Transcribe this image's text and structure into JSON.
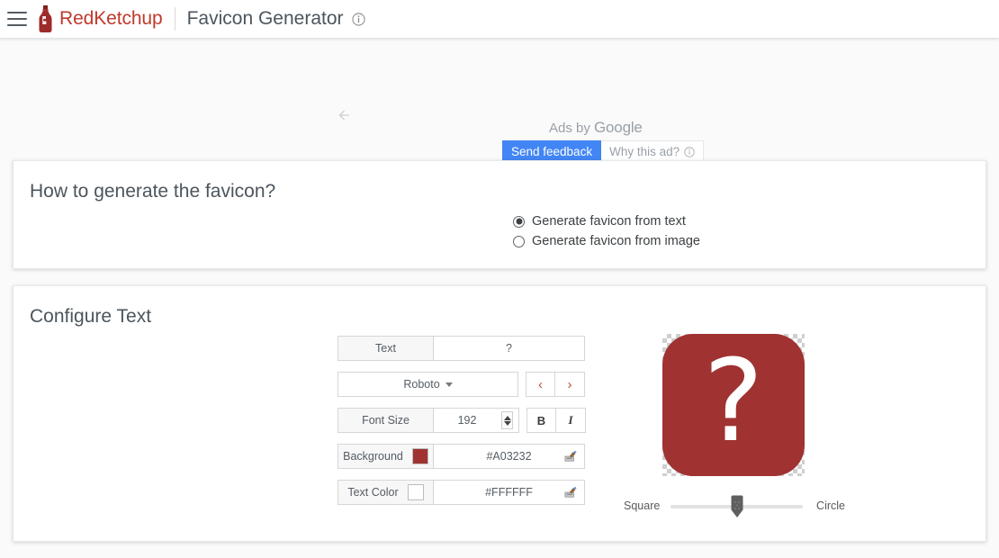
{
  "header": {
    "menu_icon": "hamburger-menu-icon",
    "logo_icon": "ketchup-bottle-logo",
    "brand": "RedKetchup",
    "page_title": "Favicon Generator",
    "info_icon": "info-circle-icon",
    "brand_color": "#c0392b",
    "title_color": "#4c555c"
  },
  "ads": {
    "back_arrow_icon": "arrow-left-icon",
    "ads_by_prefix": "Ads by ",
    "ads_by_brand": "Google",
    "send_feedback_label": "Send feedback",
    "why_this_ad_label": "Why this ad?",
    "why_this_ad_icon": "info-circle-icon",
    "feedback_button_color": "#4285f4"
  },
  "how_section": {
    "title": "How to generate the favicon?",
    "options": [
      {
        "label": "Generate favicon from text",
        "selected": true
      },
      {
        "label": "Generate favicon from image",
        "selected": false
      }
    ]
  },
  "configure_section": {
    "title": "Configure Text",
    "rows": {
      "text": {
        "label": "Text",
        "value": "?"
      },
      "font": {
        "value": "Roboto",
        "dropdown_icon": "chevron-down-icon",
        "prev_icon": "chevron-left-icon",
        "next_icon": "chevron-right-icon",
        "prev_glyph": "‹",
        "next_glyph": "›",
        "arrow_color": "#b5522f"
      },
      "font_size": {
        "label": "Font Size",
        "value": "192",
        "spinner_icon": "number-stepper-icon",
        "bold_label": "B",
        "italic_label": "I"
      },
      "background": {
        "label": "Background",
        "value": "#A03232",
        "swatch_color": "#A03232",
        "picker_icon": "color-picker-icon"
      },
      "text_color": {
        "label": "Text Color",
        "value": "#FFFFFF",
        "swatch_color": "#FFFFFF",
        "picker_icon": "color-picker-icon"
      }
    },
    "preview": {
      "glyph": "?",
      "background_color": "#A03232",
      "text_color": "#FFFFFF",
      "corner_radius_px": 34
    },
    "shape_slider": {
      "left_label": "Square",
      "right_label": "Circle",
      "handle_position_percent": 50,
      "handle_icon": "slider-handle-icon"
    }
  }
}
